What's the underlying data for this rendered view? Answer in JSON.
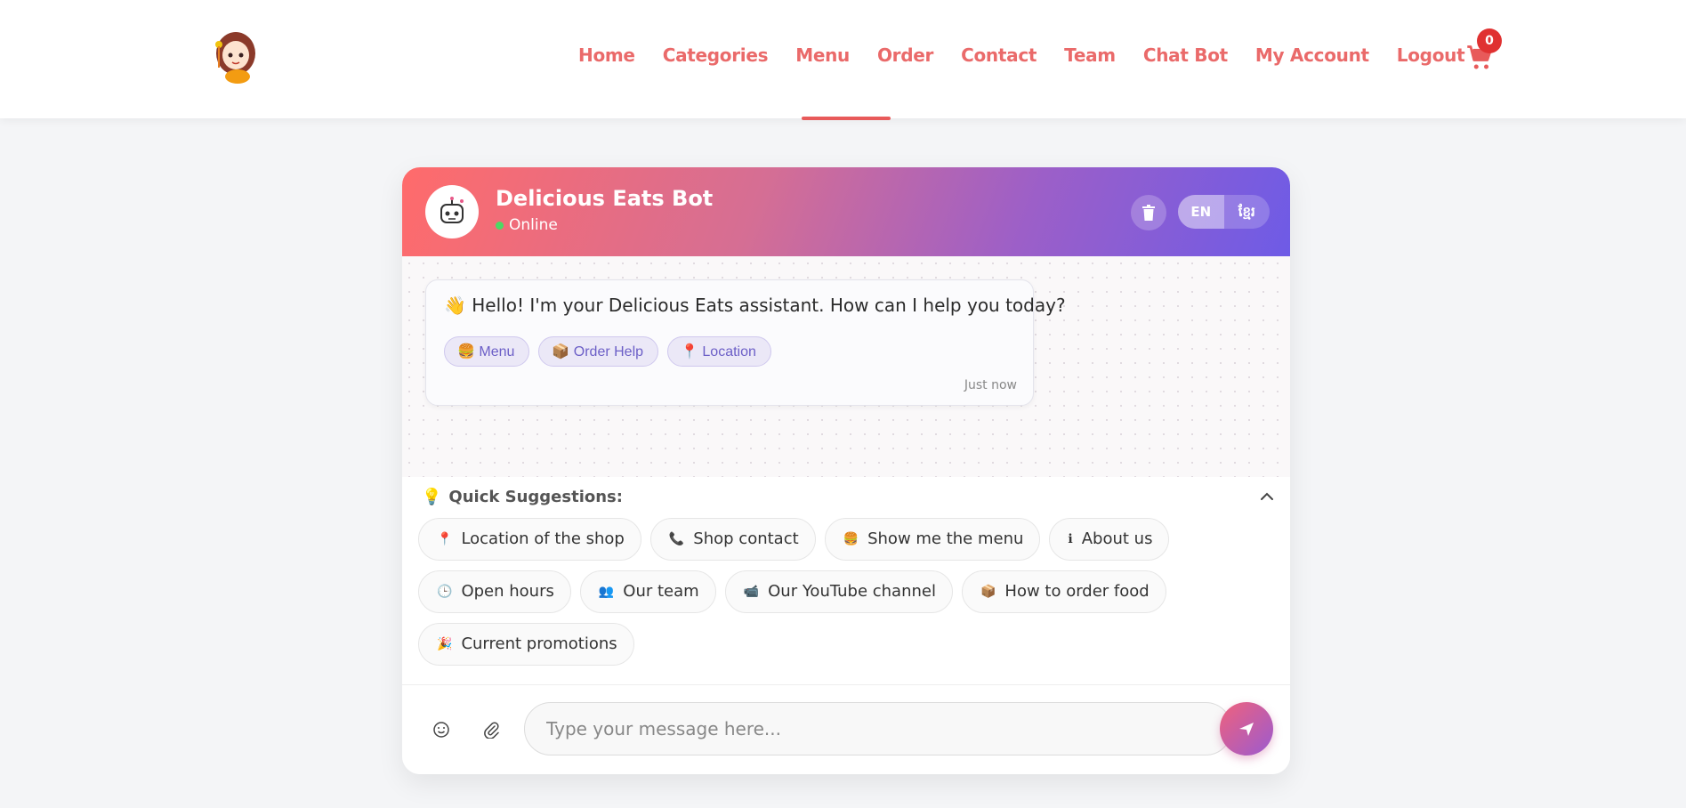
{
  "nav": {
    "links": [
      "Home",
      "Categories",
      "Menu",
      "Order",
      "Contact",
      "Team",
      "Chat Bot",
      "My Account",
      "Logout"
    ],
    "active": "Menu",
    "cart_count": "0"
  },
  "chat": {
    "bot_name": "Delicious Eats Bot",
    "status": "Online",
    "lang_en": "EN",
    "lang_km": "ខ្មែរ",
    "greeting": "👋 Hello! I'm your Delicious Eats assistant. How can I help you today?",
    "greeting_chips": [
      {
        "icon": "🍔",
        "label": "Menu"
      },
      {
        "icon": "📦",
        "label": "Order Help"
      },
      {
        "icon": "📍",
        "label": "Location"
      }
    ],
    "timestamp": "Just now"
  },
  "suggestions": {
    "title": "Quick Suggestions:",
    "title_icon": "💡",
    "rows": [
      [
        {
          "icon": "📍",
          "label": "Location of the shop"
        },
        {
          "icon": "📞",
          "label": "Shop contact"
        },
        {
          "icon": "🍔",
          "label": "Show me the menu"
        },
        {
          "icon": "ℹ",
          "label": "About us"
        }
      ],
      [
        {
          "icon": "🕒",
          "label": "Open hours"
        },
        {
          "icon": "👥",
          "label": "Our team"
        },
        {
          "icon": "📹",
          "label": "Our YouTube channel"
        },
        {
          "icon": "📦",
          "label": "How to order food"
        }
      ],
      [
        {
          "icon": "🎉",
          "label": "Current promotions"
        }
      ]
    ]
  },
  "input": {
    "placeholder": "Type your message here..."
  },
  "colors": {
    "nav_text": "#ea6a6a",
    "badge": "#e03131",
    "header_start": "#ff6b6b",
    "header_end": "#6e5be6",
    "chip_text": "#6c5fc7"
  }
}
